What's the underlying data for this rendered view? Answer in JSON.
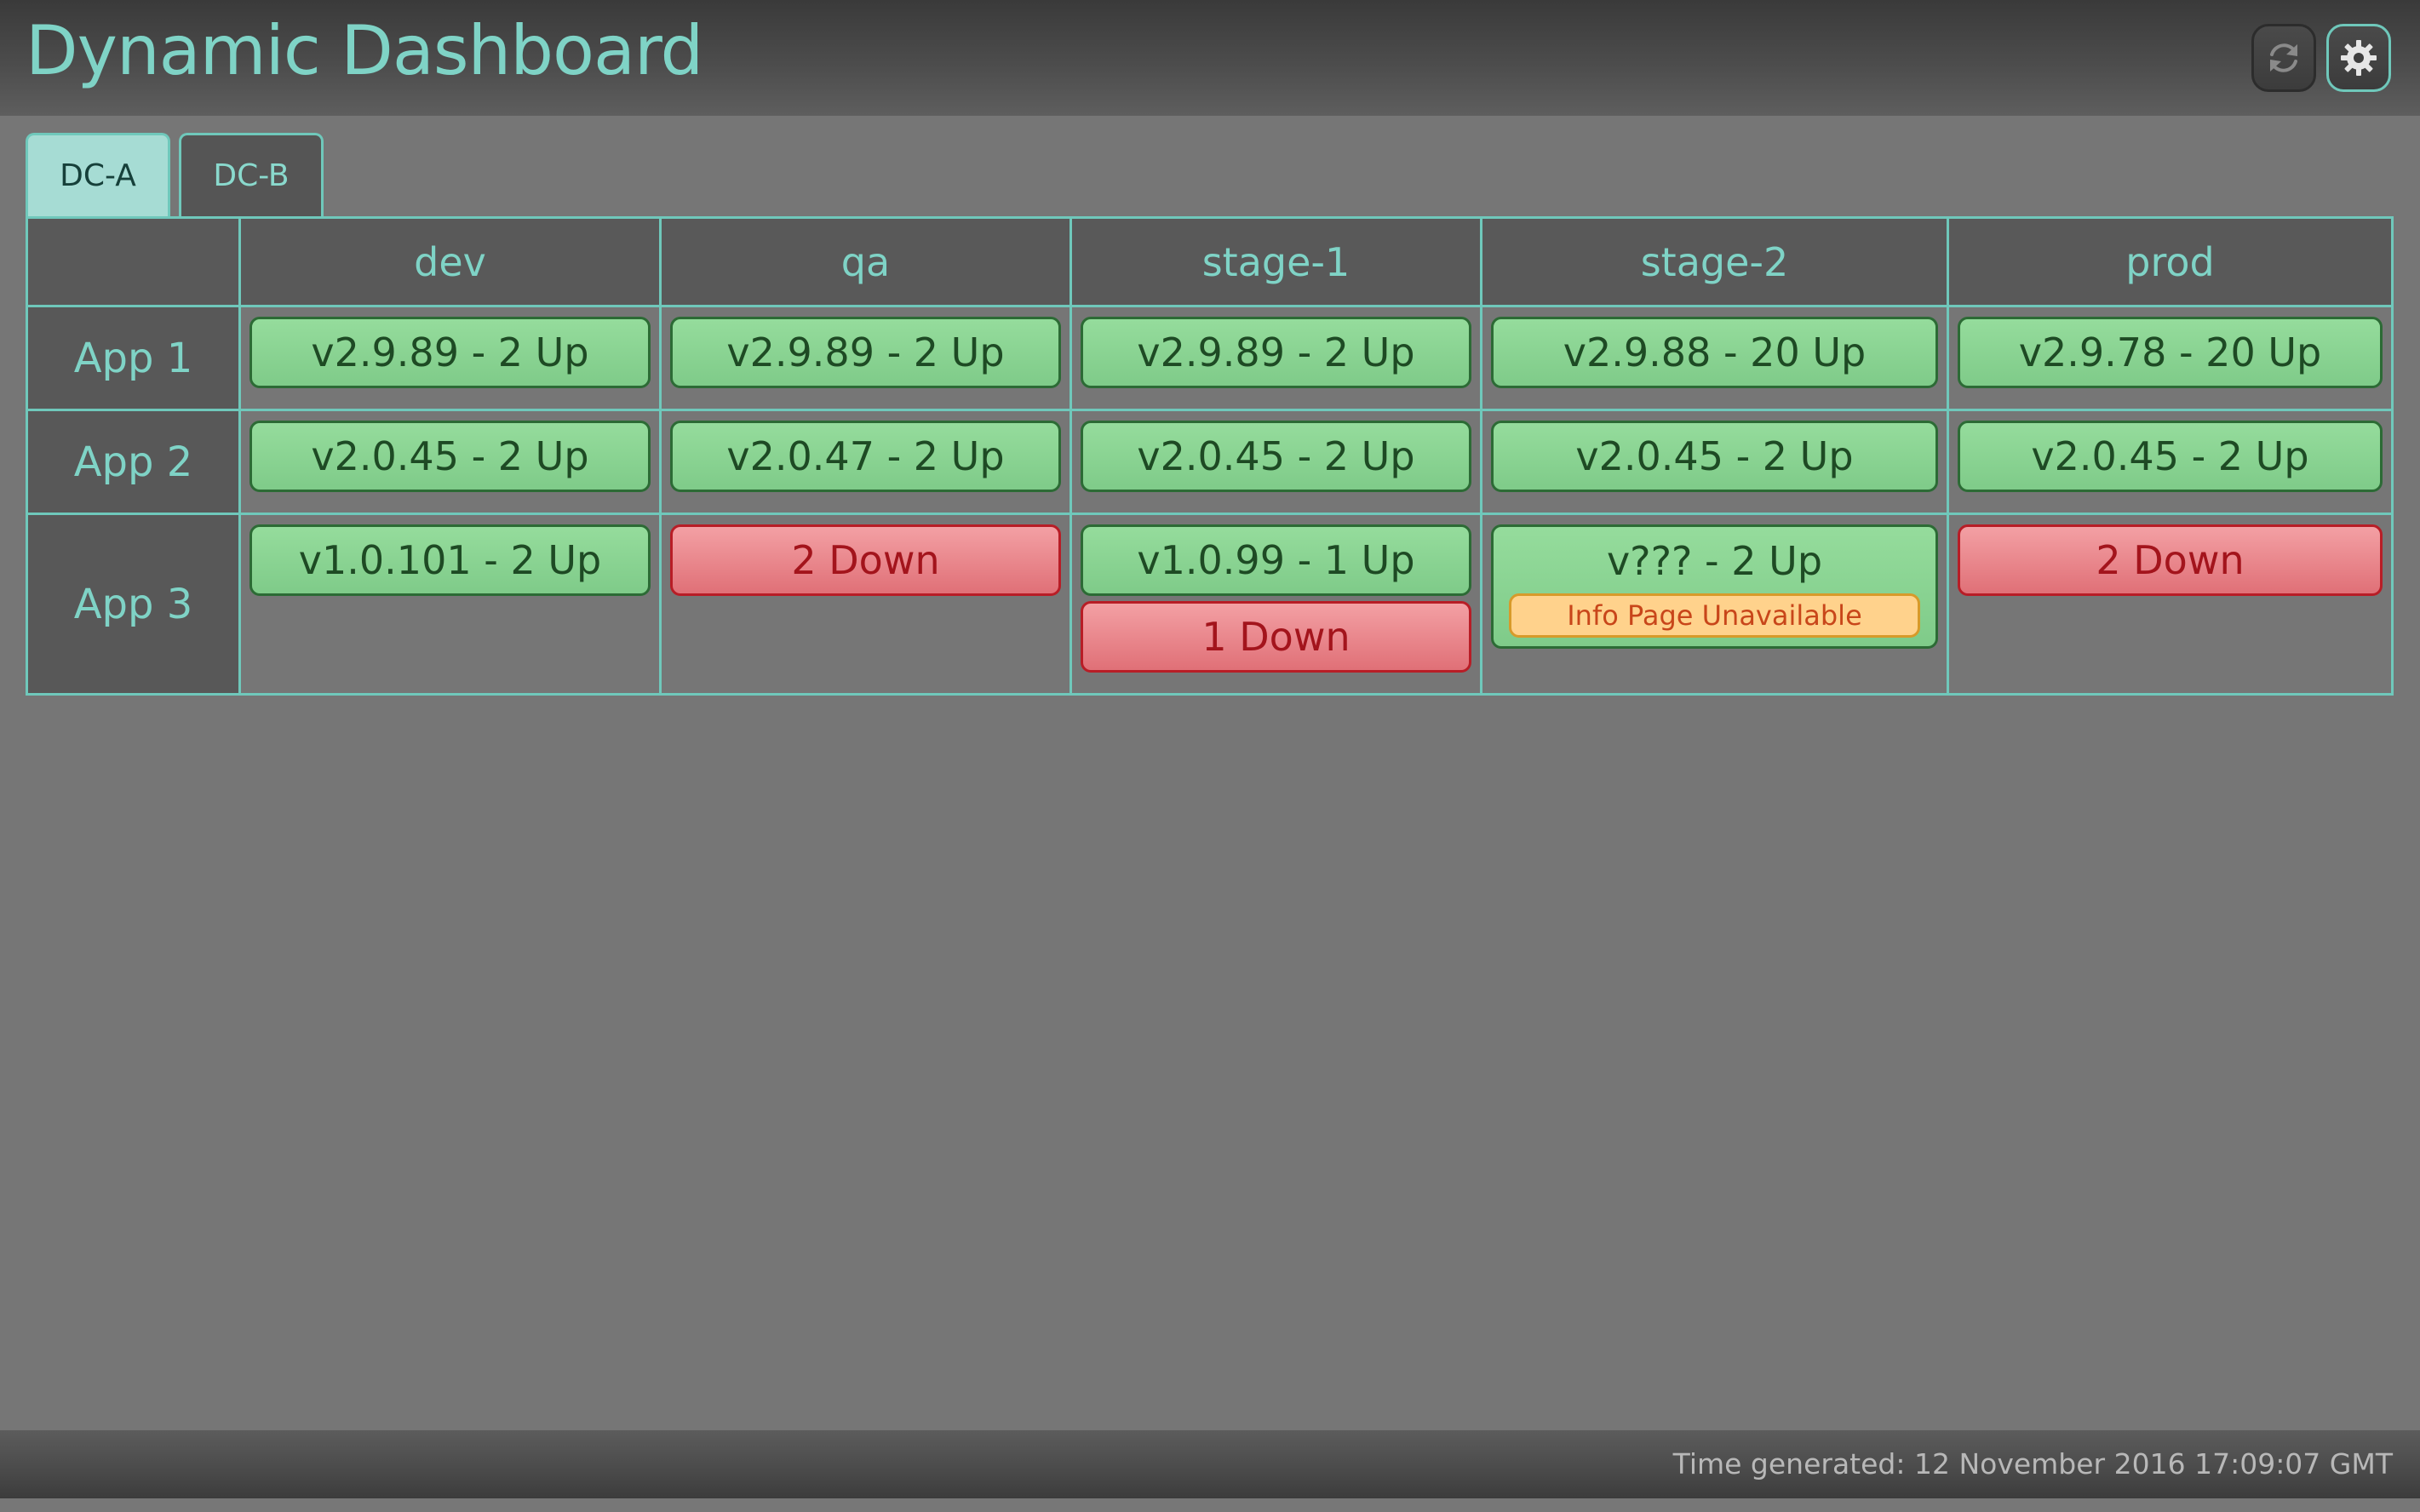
{
  "header": {
    "title": "Dynamic Dashboard",
    "refresh_icon": "refresh-icon",
    "settings_icon": "gear-icon"
  },
  "tabs": [
    {
      "label": "DC-A",
      "active": true
    },
    {
      "label": "DC-B",
      "active": false
    }
  ],
  "grid": {
    "columns": [
      "dev",
      "qa",
      "stage-1",
      "stage-2",
      "prod"
    ],
    "rows": [
      {
        "label": "App 1",
        "cells": [
          [
            {
              "status": "up",
              "text": "v2.9.89 - 2 Up"
            }
          ],
          [
            {
              "status": "up",
              "text": "v2.9.89 - 2 Up"
            }
          ],
          [
            {
              "status": "up",
              "text": "v2.9.89 - 2 Up"
            }
          ],
          [
            {
              "status": "up",
              "text": "v2.9.88 - 20 Up"
            }
          ],
          [
            {
              "status": "up",
              "text": "v2.9.78 - 20 Up"
            }
          ]
        ]
      },
      {
        "label": "App 2",
        "cells": [
          [
            {
              "status": "up",
              "text": "v2.0.45 - 2 Up"
            }
          ],
          [
            {
              "status": "up",
              "text": "v2.0.47 - 2 Up"
            }
          ],
          [
            {
              "status": "up",
              "text": "v2.0.45 - 2 Up"
            }
          ],
          [
            {
              "status": "up",
              "text": "v2.0.45 - 2 Up"
            }
          ],
          [
            {
              "status": "up",
              "text": "v2.0.45 - 2 Up"
            }
          ]
        ]
      },
      {
        "label": "App 3",
        "cells": [
          [
            {
              "status": "up",
              "text": "v1.0.101 - 2 Up"
            }
          ],
          [
            {
              "status": "down",
              "text": "2 Down"
            }
          ],
          [
            {
              "status": "up",
              "text": "v1.0.99 - 1 Up"
            },
            {
              "status": "down",
              "text": "1 Down"
            }
          ],
          [
            {
              "status": "up",
              "text": "v??? - 2 Up",
              "warning": "Info Page Unavailable"
            }
          ],
          [
            {
              "status": "down",
              "text": "2 Down"
            }
          ]
        ]
      }
    ]
  },
  "footer": {
    "time_generated": "Time generated: 12 November 2016 17:09:07 GMT"
  },
  "colors": {
    "accent": "#7fd3c6",
    "up": "#8fd597",
    "down": "#ea8a90",
    "warning": "#ffd28c"
  }
}
